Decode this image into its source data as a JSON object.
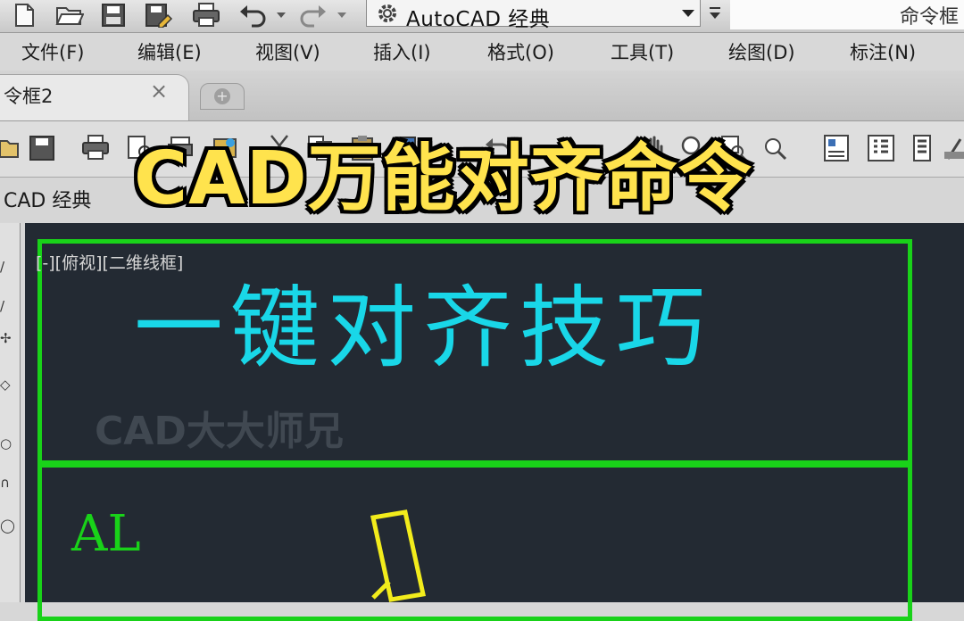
{
  "quick_access": {
    "icons": [
      "new-icon",
      "open-icon",
      "save-icon",
      "save-as-icon",
      "print-icon",
      "undo-icon",
      "undo-dropdown-icon",
      "redo-icon",
      "redo-dropdown-icon"
    ],
    "workspace_value": "AutoCAD 经典",
    "search_partial": "命令框"
  },
  "menu": {
    "items": [
      "文件(F)",
      "编辑(E)",
      "视图(V)",
      "插入(I)",
      "格式(O)",
      "工具(T)",
      "绘图(D)",
      "标注(N)"
    ]
  },
  "tabs": {
    "active_label": "令框2",
    "close_glyph": "×",
    "new_tab_glyph": "+"
  },
  "workspace_bar": {
    "label": "CAD 经典"
  },
  "overlay": {
    "title": "CAD万能对齐命令"
  },
  "drawing": {
    "viewport_label": "[-][俯视][二维线框]",
    "heading": "一键对齐技巧",
    "watermark": "CAD大大师兄",
    "al_text": "AL"
  },
  "left_palette": {
    "glyphs": [
      "/",
      "/",
      "✢",
      "◇",
      "○",
      "∩",
      "◯"
    ]
  },
  "colors": {
    "frame_green": "#19d219",
    "heading_cyan": "#19d7e8",
    "canvas_bg": "#232a33",
    "title_yellow": "#ffe34d",
    "shape_yellow": "#f2ec1c"
  }
}
